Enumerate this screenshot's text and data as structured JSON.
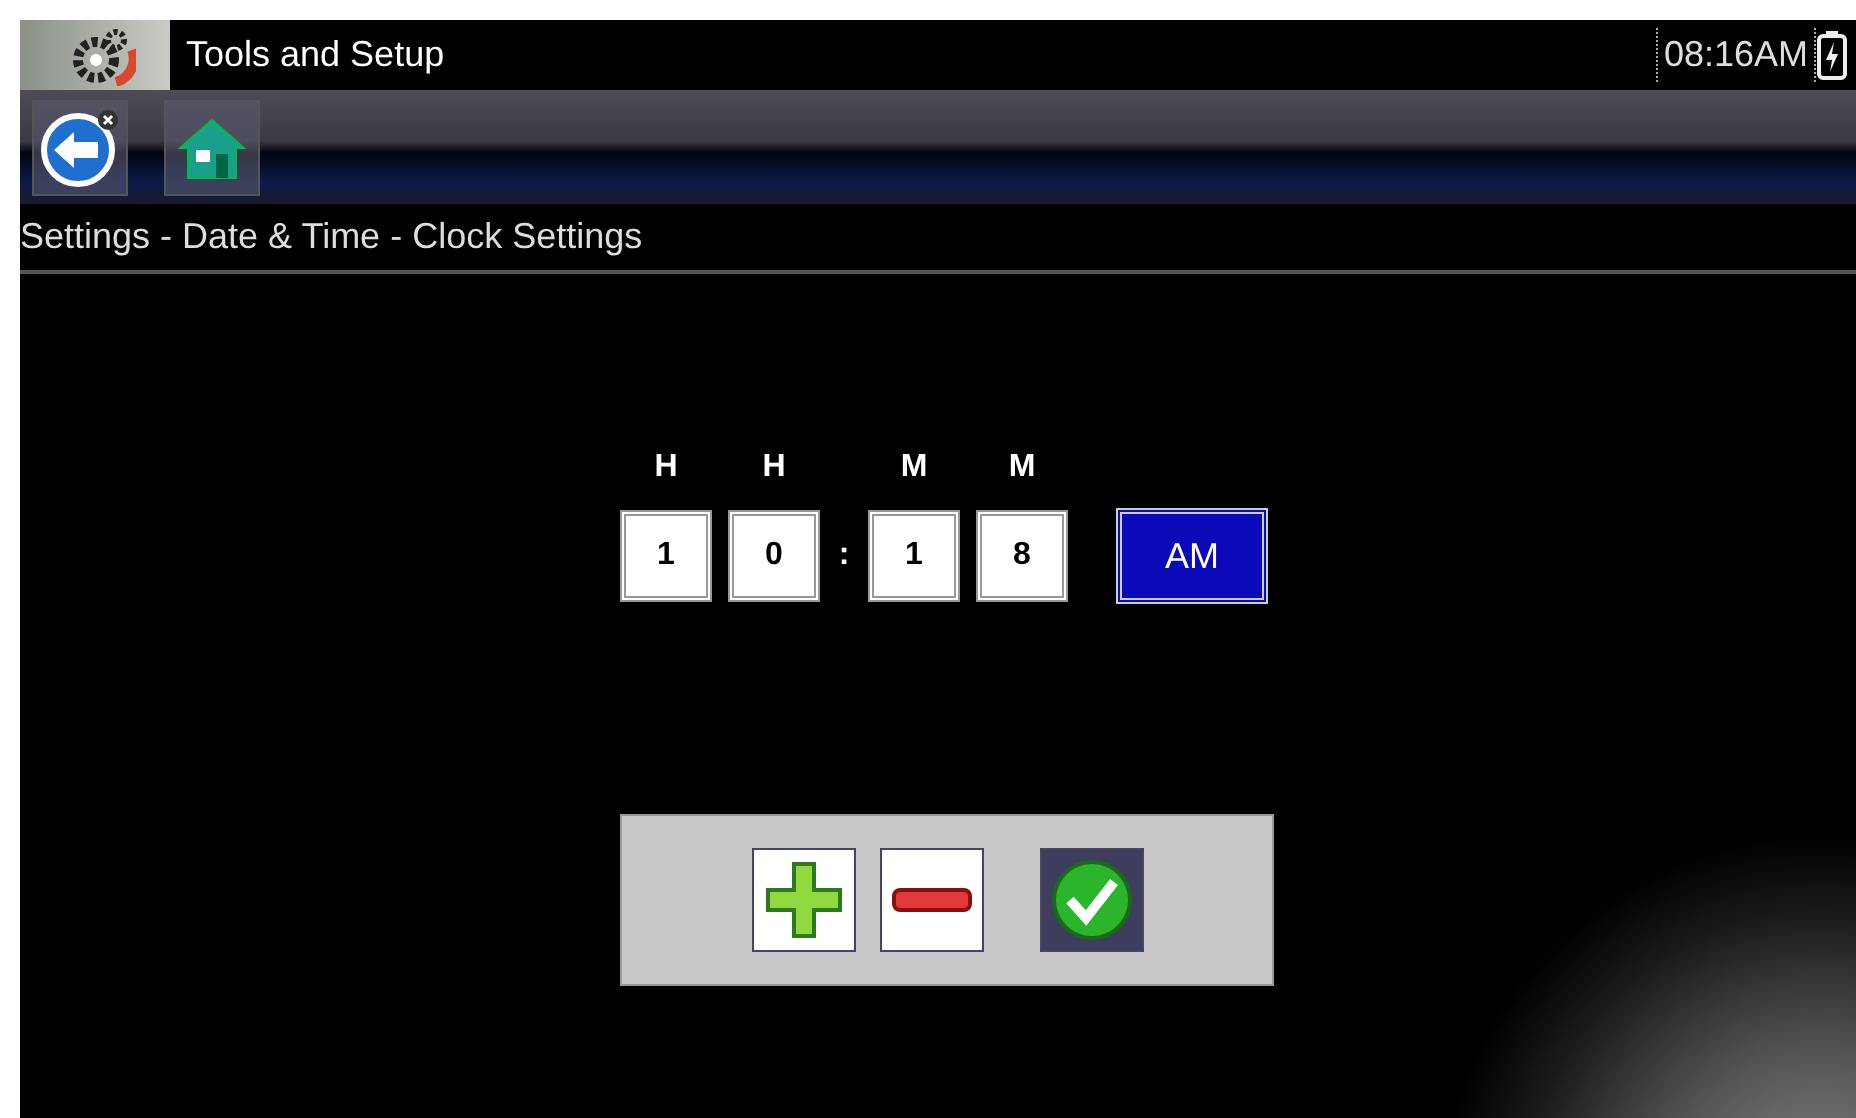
{
  "title_bar": {
    "title": "Tools and Setup",
    "clock": "08:16AM"
  },
  "breadcrumb": "Settings - Date & Time - Clock Settings",
  "time_fields": [
    {
      "label": "H",
      "value": "1"
    },
    {
      "label": "H",
      "value": "0"
    },
    {
      "label": "M",
      "value": "1"
    },
    {
      "label": "M",
      "value": "8"
    }
  ],
  "separator": ":",
  "meridiem": {
    "text": "AM",
    "selected": true
  }
}
